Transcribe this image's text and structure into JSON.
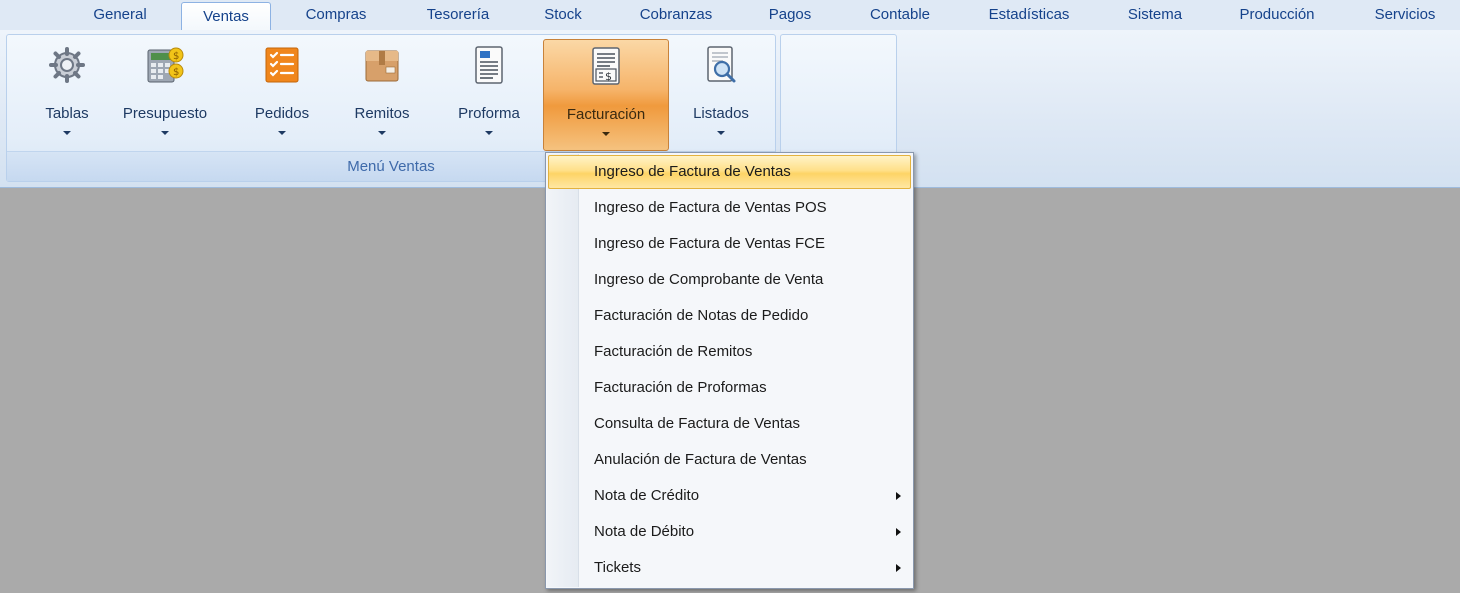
{
  "tabs": [
    "General",
    "Ventas",
    "Compras",
    "Tesorería",
    "Stock",
    "Cobranzas",
    "Pagos",
    "Contable",
    "Estadísticas",
    "Sistema",
    "Producción",
    "Servicios"
  ],
  "active_tab": "Ventas",
  "ribbon": {
    "group_caption": "Menú Ventas",
    "buttons": [
      {
        "label": "Tablas",
        "icon": "gears-icon"
      },
      {
        "label": "Presupuesto",
        "icon": "calculator-coins-icon"
      },
      {
        "label": "Pedidos",
        "icon": "checklist-icon"
      },
      {
        "label": "Remitos",
        "icon": "box-icon"
      },
      {
        "label": "Proforma",
        "icon": "document-icon"
      },
      {
        "label": "Facturación",
        "icon": "invoice-dollar-icon"
      },
      {
        "label": "Listados",
        "icon": "document-magnifier-icon"
      }
    ],
    "active_button": "Facturación"
  },
  "menu": {
    "items": [
      {
        "label": "Ingreso de Factura de Ventas",
        "highlighted": true
      },
      {
        "label": "Ingreso de Factura de Ventas POS"
      },
      {
        "label": "Ingreso de Factura de Ventas FCE"
      },
      {
        "label": "Ingreso de Comprobante de Venta"
      },
      {
        "label": "Facturación de Notas de Pedido"
      },
      {
        "label": "Facturación de Remitos"
      },
      {
        "label": "Facturación de Proformas"
      },
      {
        "label": "Consulta de Factura de Ventas"
      },
      {
        "label": "Anulación de Factura de Ventas"
      },
      {
        "label": "Nota de Crédito",
        "submenu": true
      },
      {
        "label": "Nota de Débito",
        "submenu": true
      },
      {
        "label": "Tickets",
        "submenu": true
      }
    ]
  },
  "colors": {
    "workspace": "#aaaaaa",
    "ribbon_bg": "#dfe9f5",
    "active_orange": "#f09a3d",
    "menu_highlight": "#ffe08a"
  }
}
